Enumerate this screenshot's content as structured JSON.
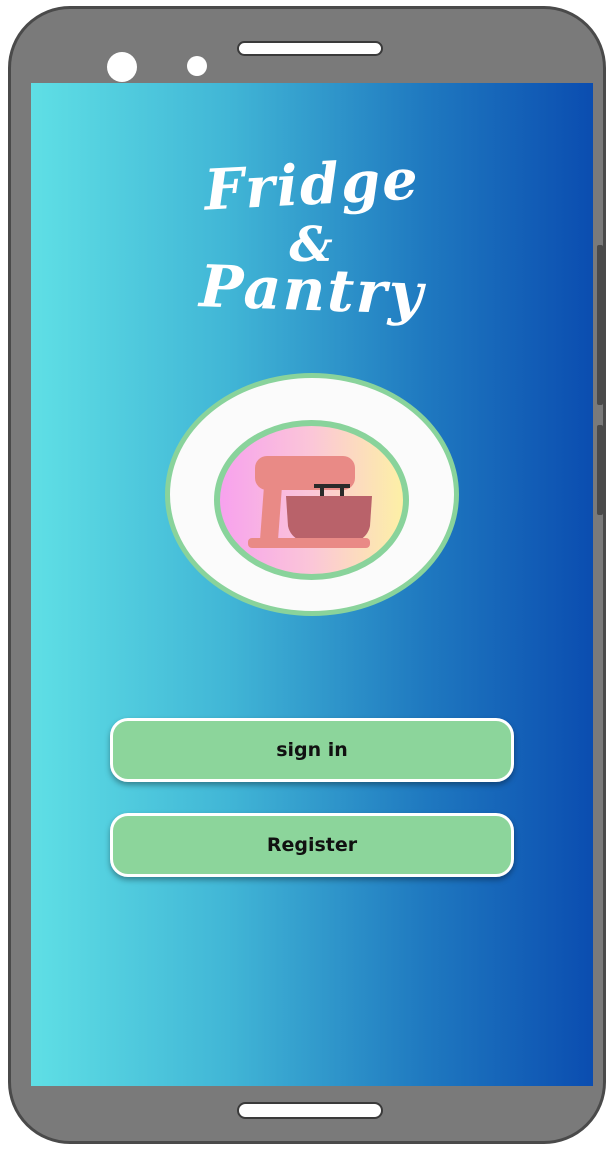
{
  "app": {
    "title_line1": "Fridge",
    "title_line2": "&",
    "title_line3": "Pantry"
  },
  "logo": {
    "icon": "stand-mixer-icon"
  },
  "actions": {
    "sign_in_label": "sign in",
    "register_label": "Register"
  },
  "colors": {
    "gradient_start": "#5fdfe5",
    "gradient_end": "#0b4db0",
    "button": "#8cd59b",
    "ring": "#89d39b"
  }
}
